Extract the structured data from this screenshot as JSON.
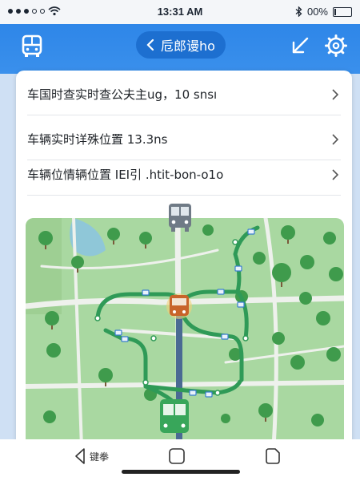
{
  "status_bar": {
    "time": "13:31 AM",
    "battery": "00%"
  },
  "header": {
    "title": "卮郎谩ho",
    "back_icon": "chevron-left-icon",
    "logo_icon": "bus-icon",
    "action_icons": [
      "collapse-arrow-icon",
      "gear-icon"
    ]
  },
  "list": {
    "items": [
      {
        "label": "车国时查实时查公夫主ug，10 snsı"
      },
      {
        "label": "车辆实时详殊位置 13.3ns"
      },
      {
        "label": "车辆位情辆位置 IEI引 .htit-bon-o1o"
      }
    ]
  },
  "bottom_nav": {
    "back_label": "键拳"
  },
  "colors": {
    "header": "#2e86e8",
    "title_pill": "#1d6fd0",
    "map_bg": "#a9d8a1",
    "route": "#2f9a57",
    "bus_active": "#c8642a",
    "bus_gray": "#6f7a86"
  }
}
